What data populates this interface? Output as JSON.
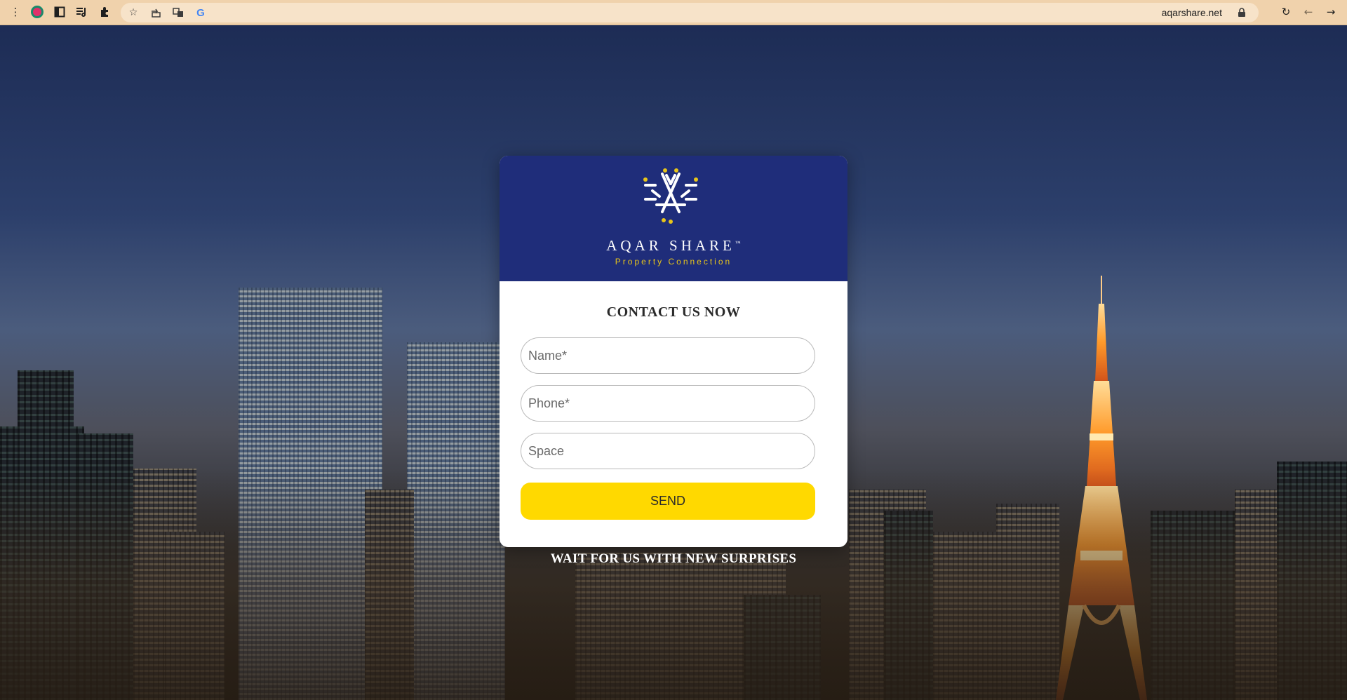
{
  "browser": {
    "url": "aqarshare.net",
    "toolbar_bg": "#f0d2ac",
    "left_icons": [
      "menu-icon",
      "profile-icon",
      "sidepanel-icon",
      "reading-list-icon",
      "extensions-icon"
    ],
    "omnibox_icons": [
      "star-icon",
      "share-icon",
      "translate-icon",
      "google-icon"
    ],
    "right_icons": [
      "lock-icon",
      "reload-icon",
      "back-icon",
      "forward-icon"
    ],
    "google_glyph": "G"
  },
  "brand": {
    "name": "AQAR SHARE",
    "trademark": "™",
    "tagline": "Property Connection",
    "header_color": "#1f2d7a",
    "accent_color": "#e8c51a"
  },
  "form": {
    "title": "CONTACT US NOW",
    "name_placeholder": "Name*",
    "phone_placeholder": "Phone*",
    "space_placeholder": "Space",
    "send_label": "SEND",
    "button_color": "#ffd900"
  },
  "footer": {
    "note": "WAIT FOR US WITH NEW SURPRISES"
  }
}
